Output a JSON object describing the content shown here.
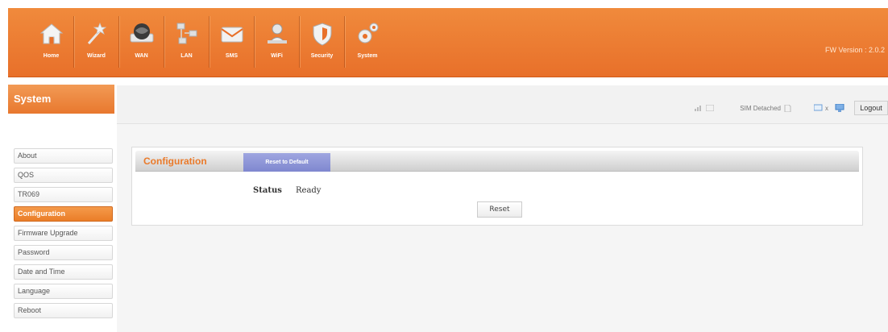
{
  "colors": {
    "accent": "#ea7a2a",
    "tab_active": "#8c93d8"
  },
  "nav": [
    {
      "label": "Home",
      "icon": "home-icon"
    },
    {
      "label": "Wizard",
      "icon": "wizard-wand-icon"
    },
    {
      "label": "WAN",
      "icon": "globe-icon"
    },
    {
      "label": "LAN",
      "icon": "network-icon"
    },
    {
      "label": "SMS",
      "icon": "envelope-icon"
    },
    {
      "label": "WiFi",
      "icon": "wifi-user-icon"
    },
    {
      "label": "Security",
      "icon": "shield-icon"
    },
    {
      "label": "System",
      "icon": "gear-icon"
    }
  ],
  "header": {
    "fw_version": "FW Version : 2.0.2"
  },
  "section": {
    "title": "System"
  },
  "status_bar": {
    "sim_status": "SIM Detached",
    "network_type": "x",
    "logout_label": "Logout"
  },
  "sidebar": {
    "items": [
      {
        "label": "About"
      },
      {
        "label": "QOS"
      },
      {
        "label": "TR069"
      },
      {
        "label": "Configuration",
        "active": true
      },
      {
        "label": "Firmware Upgrade"
      },
      {
        "label": "Password"
      },
      {
        "label": "Date and Time"
      },
      {
        "label": "Language"
      },
      {
        "label": "Reboot"
      }
    ]
  },
  "panel": {
    "title": "Configuration",
    "tab_label": "Reset to Default",
    "status_label": "Status",
    "status_value": "Ready",
    "reset_label": "Reset"
  }
}
